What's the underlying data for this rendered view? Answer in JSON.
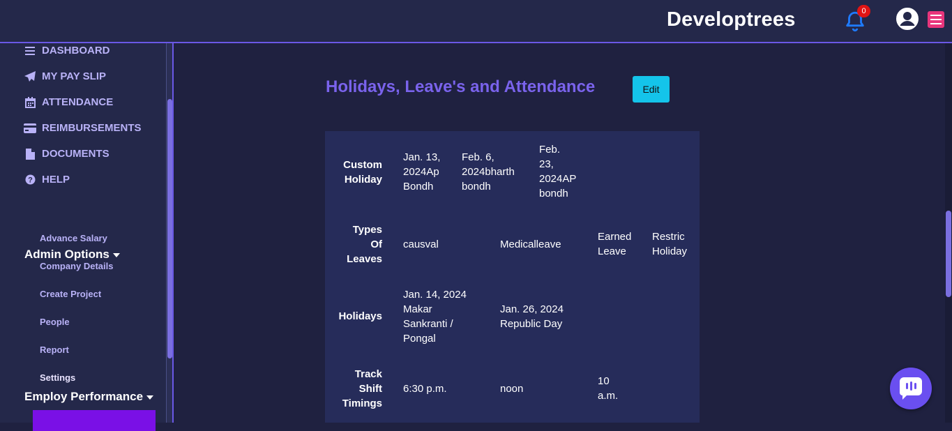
{
  "header": {
    "brand": "Developtrees",
    "notification_count": "0"
  },
  "sidebar": {
    "items": [
      {
        "label": "DASHBOARD",
        "icon": "bars-icon"
      },
      {
        "label": "MY PAY SLIP",
        "icon": "paper-plane-icon"
      },
      {
        "label": "ATTENDANCE",
        "icon": "calendar-icon"
      },
      {
        "label": "REIMBURSEMENTS",
        "icon": "credit-card-icon"
      },
      {
        "label": "DOCUMENTS",
        "icon": "file-icon"
      },
      {
        "label": "HELP",
        "icon": "question-circle-icon"
      }
    ],
    "admin_heading": "Admin Options",
    "admin_items": [
      "Advance Salary",
      "Company Details",
      "Create Project",
      "People",
      "Report",
      "Settings"
    ],
    "active_item": "Settings",
    "employ_heading": "Employ Performance"
  },
  "main": {
    "title": "Holidays, Leave's and Attendance",
    "edit_label": "Edit",
    "rows": {
      "custom_holiday": {
        "heading": [
          "Custom",
          "Holiday"
        ],
        "cells": [
          [
            "Jan. 13,",
            "2024Ap",
            "Bondh"
          ],
          [
            "Feb. 6,",
            "2024bharth",
            "bondh"
          ],
          [
            "Feb.",
            "23,",
            "2024AP",
            "bondh"
          ]
        ]
      },
      "types_of_leaves": {
        "heading": [
          "Types",
          "Of",
          "Leaves"
        ],
        "cells": [
          [
            "causval"
          ],
          [
            "Medicalleave"
          ],
          [
            "Earned",
            "Leave"
          ],
          [
            "Restric",
            "Holiday"
          ]
        ]
      },
      "holidays": {
        "heading": [
          "Holidays"
        ],
        "cells": [
          [
            "Jan. 14, 2024",
            "Makar",
            "Sankranti /",
            "Pongal"
          ],
          [
            "Jan. 26, 2024",
            "Republic Day"
          ]
        ]
      },
      "track_shift": {
        "heading": [
          "Track",
          "Shift",
          "Timings"
        ],
        "cells": [
          [
            "6:30 p.m."
          ],
          [
            "noon"
          ],
          [
            "10",
            "a.m."
          ]
        ]
      }
    }
  },
  "colors": {
    "accent": "#7a63ec",
    "active_bg": "#7a10e6",
    "edit_button": "#14c4ea",
    "menu_button": "#e8357c"
  }
}
